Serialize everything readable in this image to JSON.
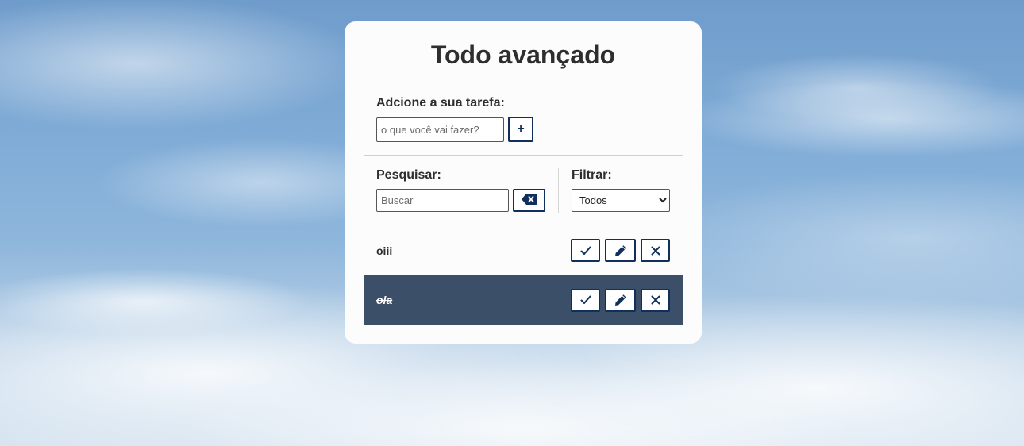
{
  "app": {
    "title": "Todo avançado"
  },
  "add_form": {
    "label": "Adcione a sua tarefa:",
    "input_placeholder": "o que você vai fazer?",
    "input_value": "",
    "add_button_label": "+"
  },
  "search": {
    "label": "Pesquisar:",
    "input_placeholder": "Buscar",
    "input_value": "",
    "clear_button_icon": "backspace-icon"
  },
  "filter": {
    "label": "Filtrar:",
    "selected": "Todos"
  },
  "todos": [
    {
      "text": "oiii",
      "done": false
    },
    {
      "text": "ola",
      "done": true
    }
  ],
  "icons": {
    "finish": "check-icon",
    "edit": "pen-icon",
    "remove": "xmark-icon"
  },
  "colors": {
    "accent": "#102f5a",
    "done_background": "#3b5068",
    "card_background": "#fcfcfc"
  }
}
